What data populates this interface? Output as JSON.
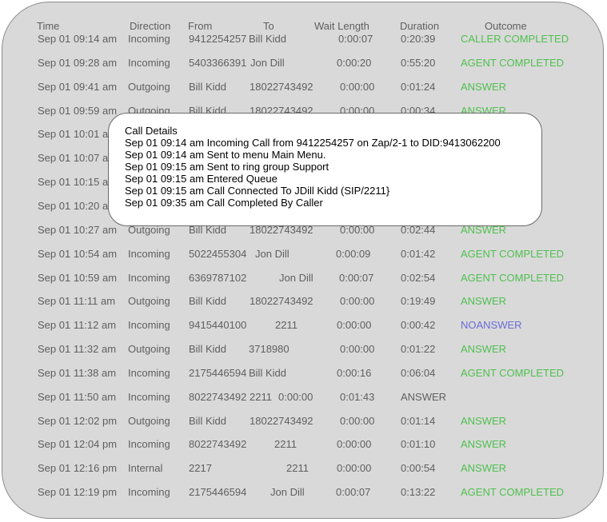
{
  "headers": {
    "time": "Time",
    "direction": "Direction",
    "from": "From",
    "to": "To",
    "wait": "Wait Length",
    "duration": "Duration",
    "outcome": "Outcome"
  },
  "rows": [
    {
      "time": "Sep 01 09:14 am",
      "direction": "Incoming",
      "from": "9412254257",
      "to": "Bill Kidd",
      "wait": "0:00:07",
      "duration": "0:20:39",
      "outcome": "CALLER COMPLETED"
    },
    {
      "time": "Sep 01 09:28 am",
      "direction": "Incoming",
      "from": "5403366391",
      "to": "Jon Dill",
      "wait": "0:00:20",
      "duration": "0:55:20",
      "outcome": "AGENT COMPLETED"
    },
    {
      "time": "Sep 01 09:41 am",
      "direction": "Outgoing",
      "from": "Bill Kidd",
      "to": "18022743492",
      "wait": "0:00:00",
      "duration": "0:01:24",
      "outcome": "ANSWER"
    },
    {
      "time": "Sep 01 09:59 am",
      "direction": "Outgoing",
      "from": "Bill Kidd",
      "to": "18022743492",
      "wait": "0:00:00",
      "duration": "0:00:34",
      "outcome": "ANSWER"
    },
    {
      "time": "Sep 01 10:01 am",
      "direction": "",
      "from": "",
      "to": "",
      "wait": "",
      "duration": "",
      "outcome": ""
    },
    {
      "time": "Sep 01 10:07 am",
      "direction": "",
      "from": "",
      "to": "",
      "wait": "",
      "duration": "",
      "outcome": "ETED"
    },
    {
      "time": "Sep 01 10:15 am",
      "direction": "",
      "from": "",
      "to": "",
      "wait": "",
      "duration": "",
      "outcome": ""
    },
    {
      "time": "Sep 01 10:20 am",
      "direction": "",
      "from": "",
      "to": "",
      "wait": "",
      "duration": "",
      "outcome": ""
    },
    {
      "time": "Sep 01 10:27 am",
      "direction": "Outgoing",
      "from": "Bill Kidd",
      "to": "18022743492",
      "wait": "0:00:00",
      "duration": "0:02:44",
      "outcome": "ANSWER"
    },
    {
      "time": "Sep 01 10:54 am",
      "direction": "Incoming",
      "from": "5022455304",
      "to": "Jon Dill",
      "wait": "0:00:09",
      "duration": "0:01:42",
      "outcome": "AGENT COMPLETED"
    },
    {
      "time": "Sep 01 10:59 am",
      "direction": "Incoming",
      "from": "6369787102",
      "to": "Jon Dill",
      "wait": "0:00:07",
      "duration": "0:02:54",
      "outcome": "AGENT COMPLETED"
    },
    {
      "time": "Sep 01 11:11 am",
      "direction": "Outgoing",
      "from": "Bill Kidd",
      "to": "18022743492",
      "wait": "0:00:00",
      "duration": "0:19:49",
      "outcome": "ANSWER"
    },
    {
      "time": "Sep 01 11:12 am",
      "direction": "Incoming",
      "from": "9415440100",
      "to": "2211",
      "wait": "0:00:00",
      "duration": "0:00:42",
      "outcome": "NOANSWER"
    },
    {
      "time": "Sep 01 11:32 am",
      "direction": "Outgoing",
      "from": "Bill Kidd",
      "to": "3718980",
      "wait": "0:00:00",
      "duration": "0:01:22",
      "outcome": "ANSWER"
    },
    {
      "time": "Sep 01 11:38 am",
      "direction": "Incoming",
      "from": "2175446594",
      "to": "Bill Kidd",
      "wait": "0:00:16",
      "duration": "0:06:04",
      "outcome": "AGENT COMPLETED"
    },
    {
      "time": "Sep 01 11:50 am",
      "direction": "Incoming",
      "from": "8022743492",
      "to": "2211",
      "wait": "0:00:00",
      "duration": "0:01:43",
      "outcome": "ANSWER"
    },
    {
      "time": "Sep 01 12:02 pm",
      "direction": "Outgoing",
      "from": "Bill Kidd",
      "to": "18022743492",
      "wait": "0:00:00",
      "duration": "0:01:14",
      "outcome": "ANSWER"
    },
    {
      "time": "Sep 01 12:04 pm",
      "direction": "Incoming",
      "from": "8022743492",
      "to": "2211",
      "wait": "0:00:00",
      "duration": "0:01:10",
      "outcome": "ANSWER"
    },
    {
      "time": "Sep 01 12:16 pm",
      "direction": "Internal",
      "from": "2217",
      "to": "2211",
      "wait": "0:00:00",
      "duration": "0:00:54",
      "outcome": "ANSWER"
    },
    {
      "time": "Sep 01 12:19 pm",
      "direction": "Incoming",
      "from": "2175446594",
      "to": "Jon Dill",
      "wait": "0:00:07",
      "duration": "0:13:22",
      "outcome": "AGENT COMPLETED"
    }
  ],
  "popup": {
    "title": "Call Details",
    "lines": [
      "Sep 01 09:14 am Incoming Call from 9412254257 on Zap/2-1 to DID:9413062200",
      "Sep 01 09:14 am Sent to menu Main Menu.",
      "Sep 01 09:15 am Sent to ring group Support",
      "Sep 01 09:15 am Entered Queue",
      "Sep 01 09:15 am Call Connected To JDill Kidd (SIP/2211}",
      "Sep 01 09:35 am Call Completed By Caller"
    ]
  },
  "colors": {
    "background": "#d9d9d9",
    "text": "#5f5f5f",
    "outcome_green": "#4fc04f",
    "outcome_blue": "#6b6bd8"
  }
}
